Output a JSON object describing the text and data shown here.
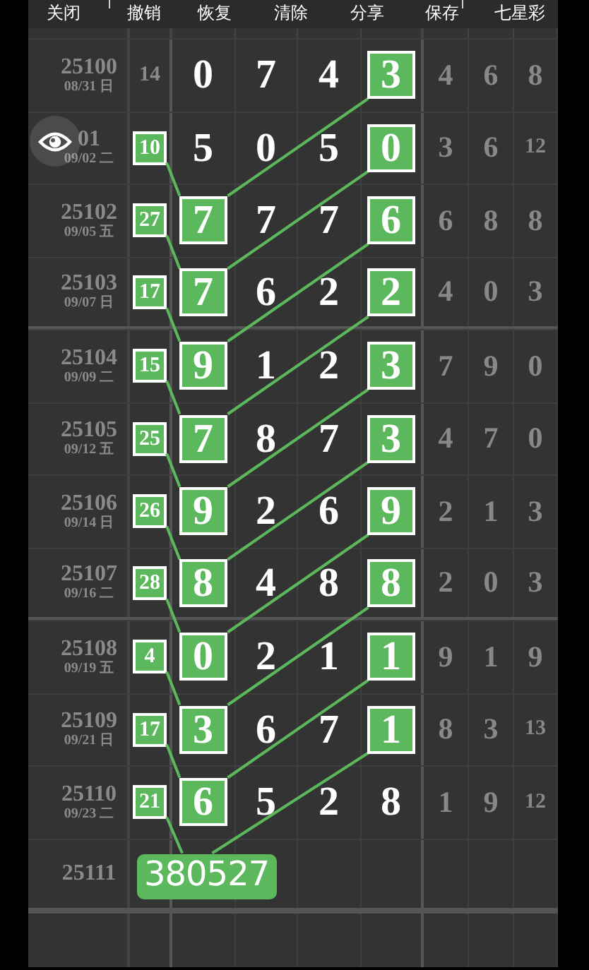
{
  "toolbar": [
    {
      "label": "关闭"
    },
    {
      "label": "撤销"
    },
    {
      "label": "恢复"
    },
    {
      "label": "清除"
    },
    {
      "label": "分享"
    },
    {
      "label": "保存"
    },
    {
      "label": "七星彩"
    }
  ],
  "rows": [
    {
      "issue": "25100",
      "date": "08/31 日",
      "count": {
        "value": "14",
        "highlighted": false
      },
      "digits": [
        {
          "value": "0",
          "highlighted": false
        },
        {
          "value": "7",
          "highlighted": false
        },
        {
          "value": "4",
          "highlighted": false
        },
        {
          "value": "3",
          "highlighted": true
        }
      ],
      "extra": [
        "4",
        "6",
        "8"
      ]
    },
    {
      "issue": "01",
      "date": "09/02 二",
      "count": {
        "value": "10",
        "highlighted": true
      },
      "digits": [
        {
          "value": "5",
          "highlighted": false
        },
        {
          "value": "0",
          "highlighted": false
        },
        {
          "value": "5",
          "highlighted": false
        },
        {
          "value": "0",
          "highlighted": true
        }
      ],
      "extra": [
        "3",
        "6",
        "12"
      ]
    },
    {
      "issue": "25102",
      "date": "09/05 五",
      "count": {
        "value": "27",
        "highlighted": true
      },
      "digits": [
        {
          "value": "7",
          "highlighted": true
        },
        {
          "value": "7",
          "highlighted": false
        },
        {
          "value": "7",
          "highlighted": false
        },
        {
          "value": "6",
          "highlighted": true
        }
      ],
      "extra": [
        "6",
        "8",
        "8"
      ]
    },
    {
      "issue": "25103",
      "date": "09/07 日",
      "count": {
        "value": "17",
        "highlighted": true
      },
      "digits": [
        {
          "value": "7",
          "highlighted": true
        },
        {
          "value": "6",
          "highlighted": false
        },
        {
          "value": "2",
          "highlighted": false
        },
        {
          "value": "2",
          "highlighted": true
        }
      ],
      "extra": [
        "4",
        "0",
        "3"
      ]
    },
    {
      "issue": "25104",
      "date": "09/09 二",
      "count": {
        "value": "15",
        "highlighted": true
      },
      "digits": [
        {
          "value": "9",
          "highlighted": true
        },
        {
          "value": "1",
          "highlighted": false
        },
        {
          "value": "2",
          "highlighted": false
        },
        {
          "value": "3",
          "highlighted": true
        }
      ],
      "extra": [
        "7",
        "9",
        "0"
      ]
    },
    {
      "issue": "25105",
      "date": "09/12 五",
      "count": {
        "value": "25",
        "highlighted": true
      },
      "digits": [
        {
          "value": "7",
          "highlighted": true
        },
        {
          "value": "8",
          "highlighted": false
        },
        {
          "value": "7",
          "highlighted": false
        },
        {
          "value": "3",
          "highlighted": true
        }
      ],
      "extra": [
        "4",
        "7",
        "0"
      ]
    },
    {
      "issue": "25106",
      "date": "09/14 日",
      "count": {
        "value": "26",
        "highlighted": true
      },
      "digits": [
        {
          "value": "9",
          "highlighted": true
        },
        {
          "value": "2",
          "highlighted": false
        },
        {
          "value": "6",
          "highlighted": false
        },
        {
          "value": "9",
          "highlighted": true
        }
      ],
      "extra": [
        "2",
        "1",
        "3"
      ]
    },
    {
      "issue": "25107",
      "date": "09/16 二",
      "count": {
        "value": "28",
        "highlighted": true
      },
      "digits": [
        {
          "value": "8",
          "highlighted": true
        },
        {
          "value": "4",
          "highlighted": false
        },
        {
          "value": "8",
          "highlighted": false
        },
        {
          "value": "8",
          "highlighted": true
        }
      ],
      "extra": [
        "2",
        "0",
        "3"
      ]
    },
    {
      "issue": "25108",
      "date": "09/19 五",
      "count": {
        "value": "4",
        "highlighted": true
      },
      "digits": [
        {
          "value": "0",
          "highlighted": true
        },
        {
          "value": "2",
          "highlighted": false
        },
        {
          "value": "1",
          "highlighted": false
        },
        {
          "value": "1",
          "highlighted": true
        }
      ],
      "extra": [
        "9",
        "1",
        "9"
      ]
    },
    {
      "issue": "25109",
      "date": "09/21 日",
      "count": {
        "value": "17",
        "highlighted": true
      },
      "digits": [
        {
          "value": "3",
          "highlighted": true
        },
        {
          "value": "6",
          "highlighted": false
        },
        {
          "value": "7",
          "highlighted": false
        },
        {
          "value": "1",
          "highlighted": true
        }
      ],
      "extra": [
        "8",
        "3",
        "13"
      ]
    },
    {
      "issue": "25110",
      "date": "09/23 二",
      "count": {
        "value": "21",
        "highlighted": true
      },
      "digits": [
        {
          "value": "6",
          "highlighted": true
        },
        {
          "value": "5",
          "highlighted": false
        },
        {
          "value": "2",
          "highlighted": false
        },
        {
          "value": "8",
          "highlighted": false
        }
      ],
      "extra": [
        "1",
        "9",
        "12"
      ]
    },
    {
      "issue": "25111"
    }
  ],
  "prediction": "380527"
}
